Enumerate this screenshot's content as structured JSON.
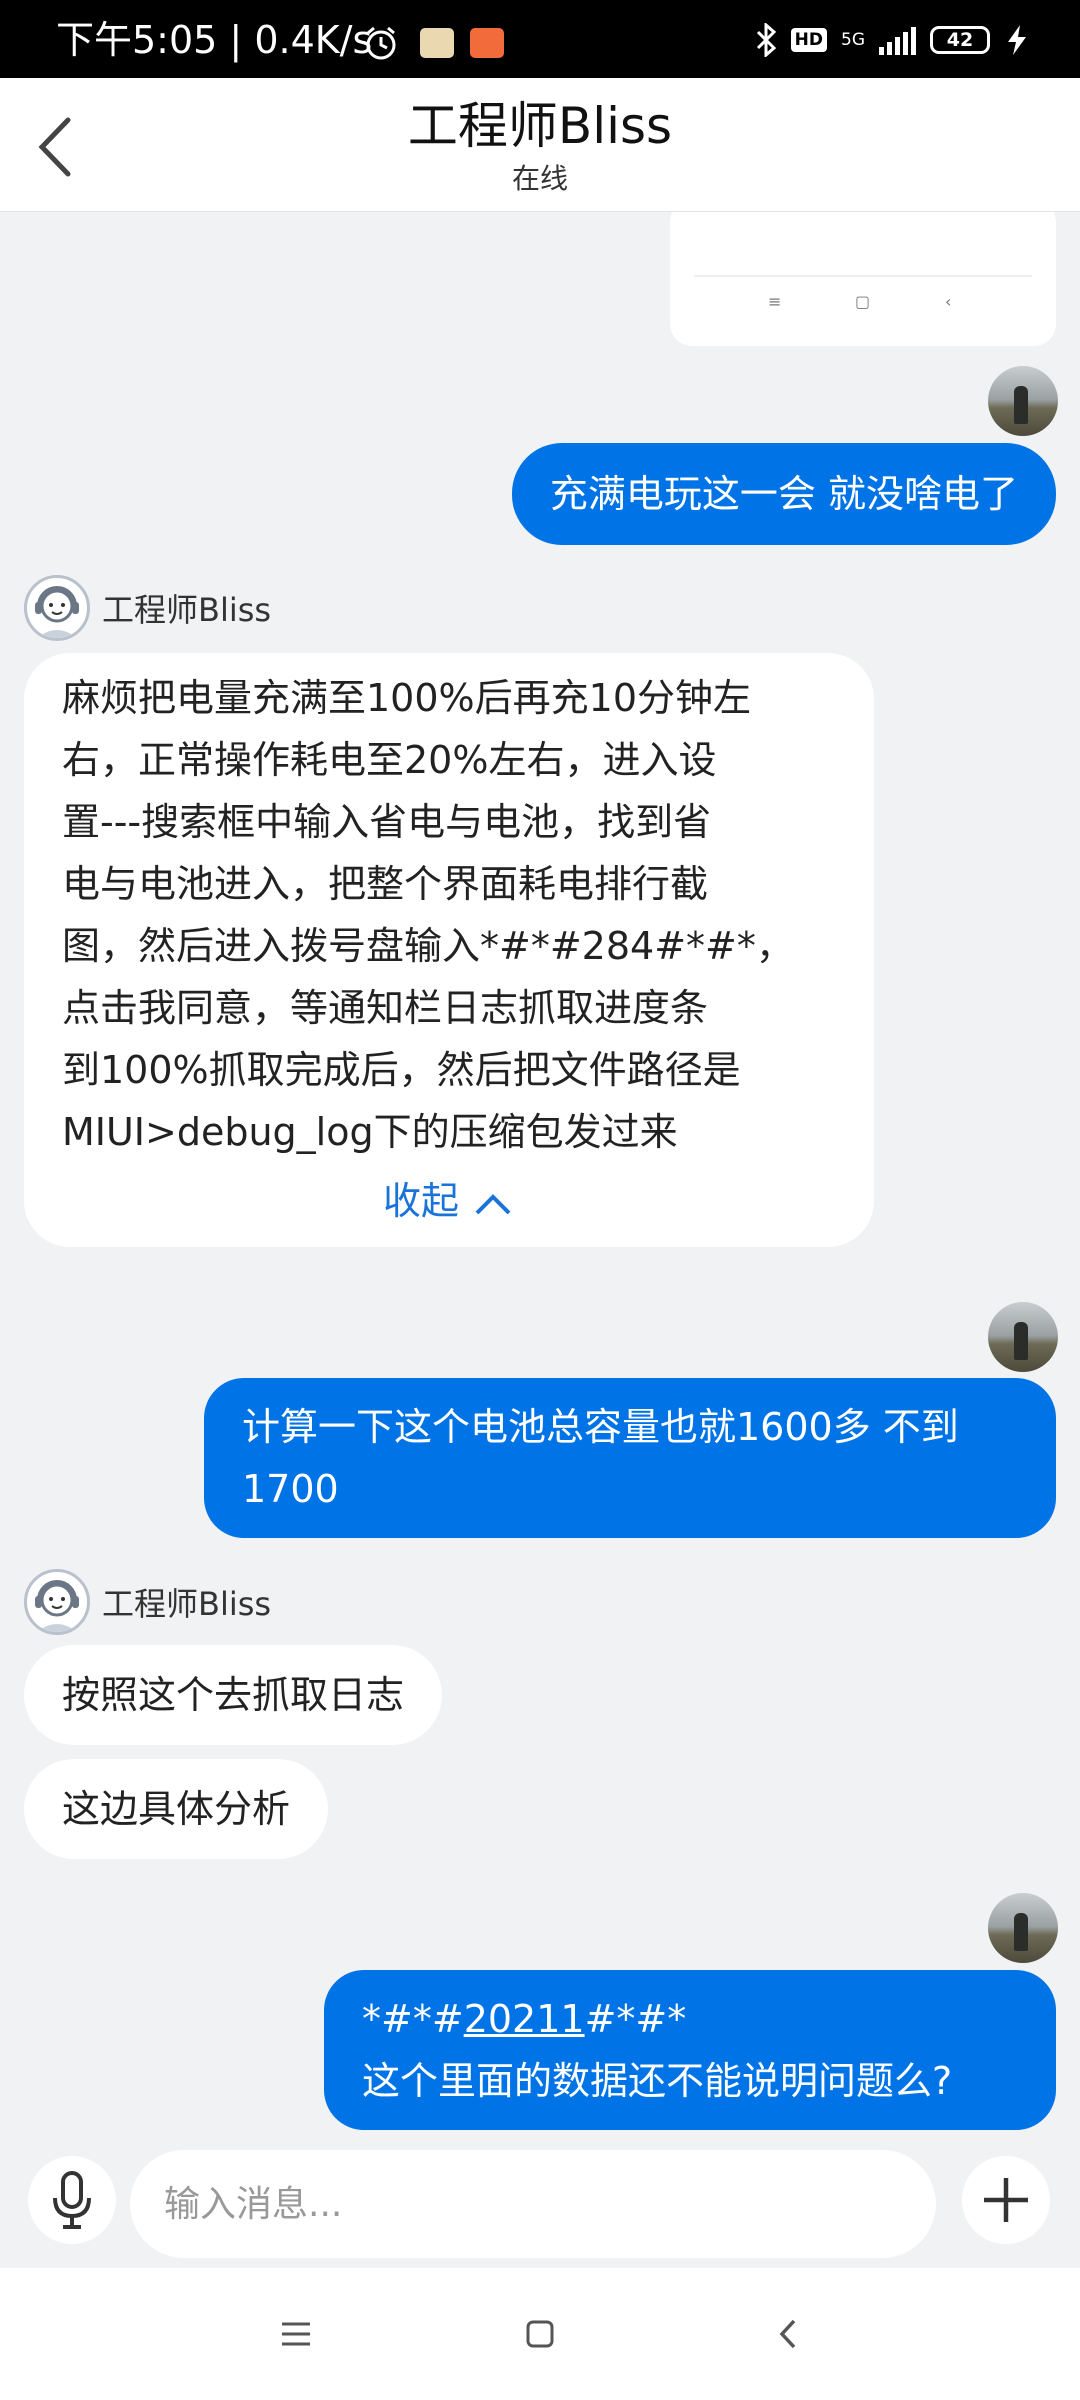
{
  "status_bar": {
    "time": "下午5:05",
    "speed": "0.4K/s",
    "network_hd": "HD",
    "network_type": "5G",
    "battery": "42",
    "icons": [
      "alarm-icon",
      "app-notification-icon",
      "app-notification-icon",
      "bluetooth-icon",
      "signal-icon",
      "battery-icon",
      "charging-icon"
    ]
  },
  "header": {
    "title": "工程师Bliss",
    "subtitle": "在线",
    "back_icon": "chevron-left-icon"
  },
  "messages": [
    {
      "from": "me",
      "text": "充满电玩这一会  就没啥电了"
    },
    {
      "from": "agent",
      "sender": "工程师Bliss",
      "lines": [
        "麻烦把电量充满至100%后再充10分钟左",
        "右，正常操作耗电至20%左右，进入设",
        "置---搜索框中输入省电与电池，找到省",
        "电与电池进入，把整个界面耗电排行截",
        "图，然后进入拨号盘输入*#*#284#*#*，",
        "点击我同意，等通知栏日志抓取进度条",
        "到100%抓取完成后，然后把文件路径是",
        "MIUI>debug_log下的压缩包发过来"
      ],
      "collapse_label": "收起"
    },
    {
      "from": "me",
      "lines": [
        "计算一下这个电池总容量也就1600多 不到",
        "1700"
      ]
    },
    {
      "from": "agent",
      "sender": "工程师Bliss",
      "texts": [
        "按照这个去抓取日志",
        "这边具体分析"
      ]
    },
    {
      "from": "me",
      "code_prefix": "*#*#",
      "code_link": "20211",
      "code_suffix": "#*#*",
      "line2": "这个里面的数据还不能说明问题么?"
    }
  ],
  "input": {
    "placeholder": "输入消息..."
  },
  "colors": {
    "accent": "#0073e6",
    "background": "#f1f2f3",
    "link": "#1a73d9"
  }
}
